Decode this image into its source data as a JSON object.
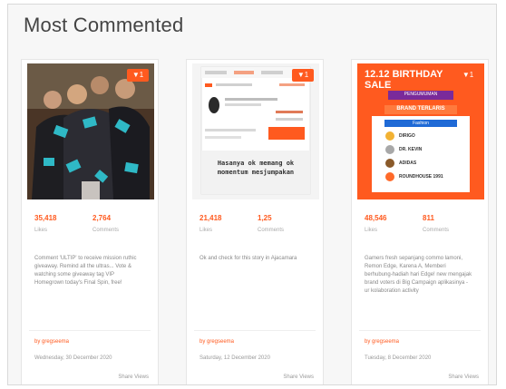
{
  "widget": {
    "title": "Most Commented"
  },
  "cards": [
    {
      "badge": "1",
      "likes": "35,418",
      "likes_label": "Likes",
      "comments": "2,764",
      "comments_label": "Comments",
      "caption": "Comment 'ULTIP' to receive mission ruthic giveaway. Remind all the ultras... Vote & watching some giveaway tag VIP Homegrown today's Final Spin, free!",
      "handle": "by gregseema",
      "date": "Wednesday, 30 December 2020",
      "share": "Share Views"
    },
    {
      "badge": "1",
      "likes": "21,418",
      "likes_label": "Likes",
      "comments": "1,25",
      "comments_label": "Comments",
      "caption": "Ok and check for this story in Ajacamara",
      "handle": "by gregseema",
      "date": "Saturday, 12 December 2020",
      "share": "Share Views",
      "screen_text": "Hasanya ok memang ok momentum mesjumpakan"
    },
    {
      "badge": "1",
      "likes": "48,546",
      "likes_label": "Likes",
      "comments": "811",
      "comments_label": "Comments",
      "caption": "Gamers fresh sepanjang commo lamoni, Remon Edge, Karena A, Memberi berhubung-hadiah hari Edge! new mengajak brand voters di Big Campaign aplikasinya - ur kolaboration activity",
      "handle": "by gregseema",
      "date": "Tuesday, 8 December 2020",
      "share": "Share Views",
      "promo": {
        "headline": "12.12 BIRTHDAY SALE",
        "tag": "PENGUMUMAN",
        "subhead": "BRAND TERLARIS",
        "kategori": "Fashion",
        "items": [
          "DIRIGO",
          "DR. KEVIN",
          "ADIDAS",
          "ROUNDHOUSE 1991"
        ]
      }
    }
  ],
  "colors": {
    "accent": "#ff5a1f",
    "panel": "#f7f7f7"
  }
}
